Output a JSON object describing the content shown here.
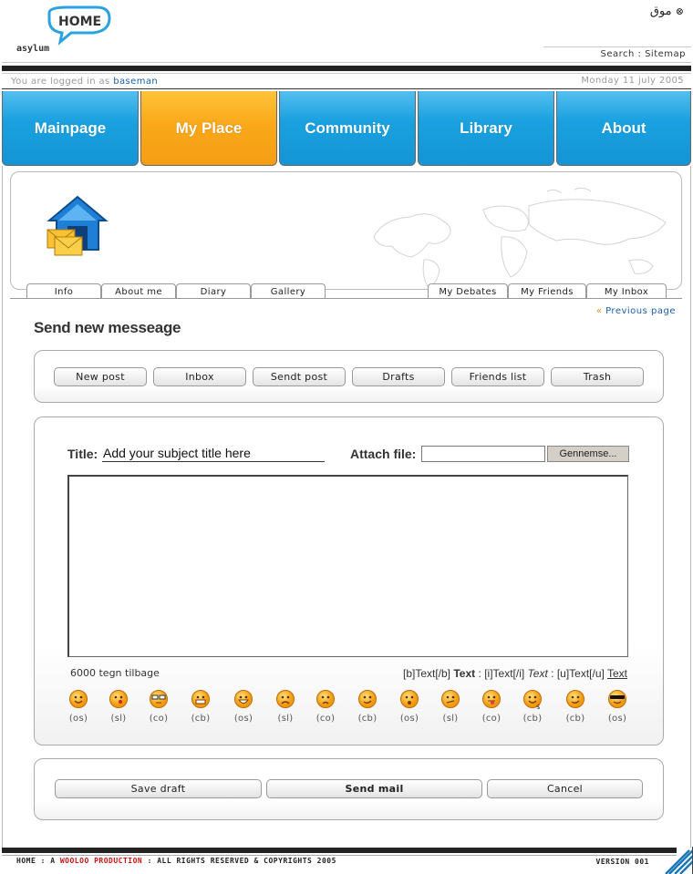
{
  "header": {
    "logo_top": "HOME",
    "logo_bottom": "asylum",
    "language_link": "موق",
    "top_nav": "Search : Sitemap"
  },
  "userbar": {
    "logged_prefix": "You are logged in as",
    "username": "baseman",
    "date": "Monday 11 july 2005"
  },
  "main_tabs": [
    {
      "label": "Mainpage"
    },
    {
      "label": "My Place"
    },
    {
      "label": "Community"
    },
    {
      "label": "Library"
    },
    {
      "label": "About"
    }
  ],
  "sub_tabs_left": [
    {
      "label": "Info"
    },
    {
      "label": "About me"
    },
    {
      "label": "Diary"
    },
    {
      "label": "Gallery"
    }
  ],
  "sub_tabs_right": [
    {
      "label": "My Debates"
    },
    {
      "label": "My Friends"
    },
    {
      "label": "My Inbox"
    }
  ],
  "page": {
    "title": "Send new messeage",
    "previous_link": "Previous page",
    "previous_arrows": "«"
  },
  "mail_nav": [
    {
      "label": "New post"
    },
    {
      "label": "Inbox"
    },
    {
      "label": "Sendt post"
    },
    {
      "label": "Drafts"
    },
    {
      "label": "Friends list"
    },
    {
      "label": "Trash"
    }
  ],
  "compose": {
    "title_label": "Title:",
    "title_value": "Add your subject title here",
    "attach_label": "Attach file:",
    "browse_label": "Gennemse...",
    "char_count": "6000 tegn tilbage",
    "fmt_b": "[b]Text[/b]",
    "fmt_b_sample": "Text",
    "fmt_i": "[i]Text[/i]",
    "fmt_i_sample": "Text",
    "fmt_u": "[u]Text[/u]",
    "fmt_u_sample": "Text",
    "sep": ":"
  },
  "smileys": [
    {
      "code": "(os)",
      "icon": "smile-icon"
    },
    {
      "code": "(sl)",
      "icon": "kiss-icon"
    },
    {
      "code": "(co)",
      "icon": "glasses-icon"
    },
    {
      "code": "(cb)",
      "icon": "grin-teeth-icon"
    },
    {
      "code": "(os)",
      "icon": "laugh-icon"
    },
    {
      "code": "(sl)",
      "icon": "sad-icon"
    },
    {
      "code": "(co)",
      "icon": "frown-icon"
    },
    {
      "code": "(cb)",
      "icon": "wink-icon"
    },
    {
      "code": "(os)",
      "icon": "surprised-icon"
    },
    {
      "code": "(sl)",
      "icon": "confused-icon"
    },
    {
      "code": "(co)",
      "icon": "tongue-icon"
    },
    {
      "code": "(cb)",
      "icon": "money-icon"
    },
    {
      "code": "(cb)",
      "icon": "cheeky-icon"
    },
    {
      "code": "(os)",
      "icon": "sunglasses-icon"
    }
  ],
  "actions": {
    "save": "Save draft",
    "send": "Send mail",
    "cancel": "Cancel"
  },
  "footer": {
    "text_a": "HOME : A",
    "text_brand": "WOOLOO PRODUCTION",
    "text_b": ": ALL RIGHTS RESERVED & COPYRIGHTS 2005",
    "version": "VERSION 001"
  },
  "colors": {
    "tab_blue": "#1aa1e0",
    "tab_active_orange": "#f9a81a",
    "link_blue": "#1a5fa8",
    "footer_red": "#d01010"
  }
}
